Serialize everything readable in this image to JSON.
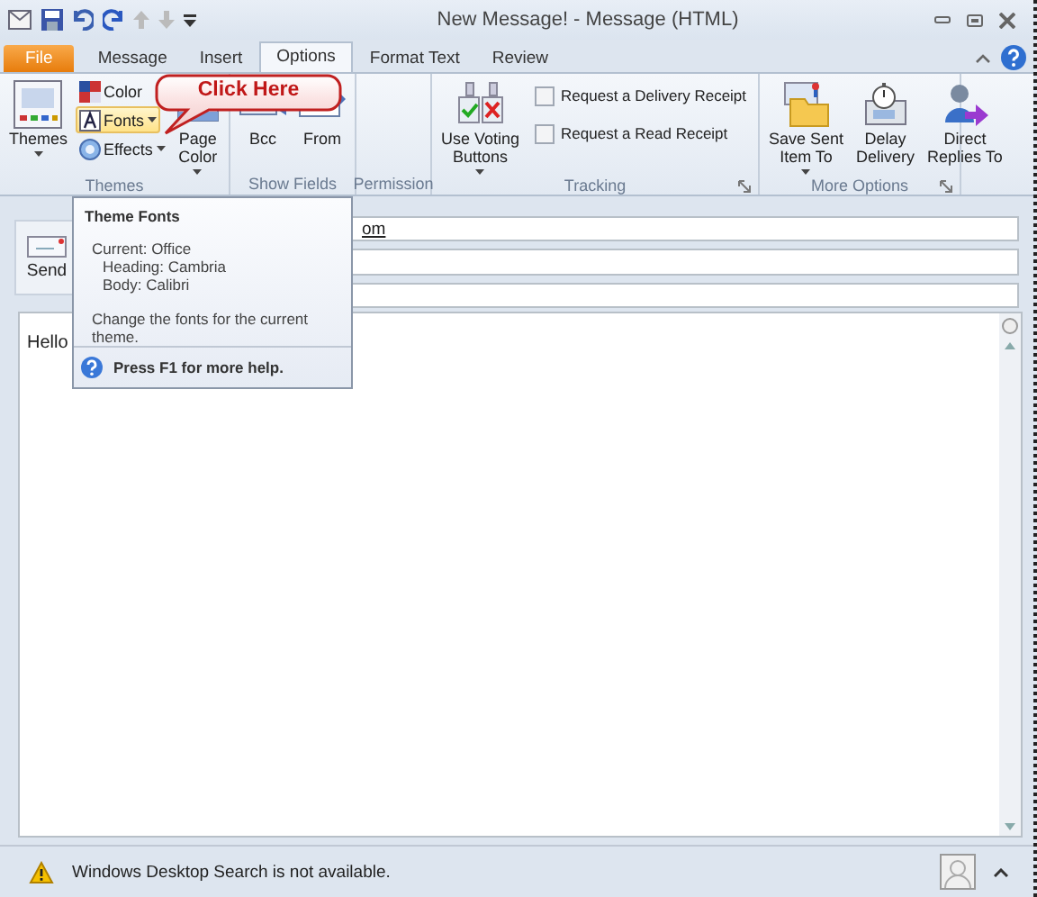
{
  "window": {
    "title": "New Message! - Message (HTML)"
  },
  "tabs": [
    {
      "label": "File",
      "kind": "file",
      "selected": false
    },
    {
      "label": "Message",
      "kind": "tab",
      "selected": false
    },
    {
      "label": "Insert",
      "kind": "tab",
      "selected": false
    },
    {
      "label": "Options",
      "kind": "tab",
      "selected": true
    },
    {
      "label": "Format Text",
      "kind": "tab",
      "selected": false
    },
    {
      "label": "Review",
      "kind": "tab",
      "selected": false
    }
  ],
  "ribbon": {
    "groups": [
      {
        "label": "Themes",
        "launcher": false,
        "columns": [
          [
            {
              "kind": "large",
              "label": "Themes",
              "dropdown": true,
              "highlighted": false
            }
          ],
          [
            {
              "kind": "small",
              "label": "Color",
              "dropdown": false,
              "highlighted": false
            },
            {
              "kind": "small",
              "label": "Fonts",
              "dropdown": true,
              "highlighted": true
            },
            {
              "kind": "small",
              "label": "Effects",
              "dropdown": true,
              "highlighted": false
            }
          ],
          [
            {
              "kind": "large",
              "label": "Page\nColor",
              "dropdown": true,
              "highlighted": false
            }
          ]
        ]
      },
      {
        "label": "Show Fields",
        "launcher": false,
        "columns": [
          [
            {
              "kind": "large",
              "label": "Bcc",
              "dropdown": false,
              "highlighted": false
            }
          ],
          [
            {
              "kind": "large",
              "label": "From",
              "dropdown": false,
              "highlighted": false
            }
          ]
        ]
      },
      {
        "label": "Permission",
        "launcher": false
      },
      {
        "label": "Tracking",
        "launcher": true,
        "columns": [
          [
            {
              "kind": "large",
              "label": "Use Voting\nButtons",
              "dropdown": true,
              "highlighted": false
            }
          ],
          [
            {
              "kind": "check",
              "label": "Request a Delivery Receipt",
              "checked": false
            },
            {
              "kind": "check",
              "label": "Request a Read Receipt",
              "checked": false
            }
          ]
        ]
      },
      {
        "label": "More Options",
        "launcher": true,
        "columns": [
          [
            {
              "kind": "large",
              "label": "Save Sent\nItem To",
              "dropdown": true,
              "highlighted": false
            }
          ],
          [
            {
              "kind": "large",
              "label": "Delay\nDelivery",
              "dropdown": false,
              "highlighted": false
            }
          ],
          [
            {
              "kind": "large",
              "label": "Direct\nReplies To",
              "dropdown": false,
              "highlighted": false
            }
          ]
        ]
      }
    ]
  },
  "callout": {
    "text": "Click Here"
  },
  "tooltip": {
    "title": "Theme Fonts",
    "lines": [
      {
        "text": "Current: Office",
        "children": [
          {
            "text": "Heading: Cambria"
          },
          {
            "text": "Body: Calibri"
          }
        ]
      }
    ],
    "description": "Change the fonts for the current theme.",
    "help": "Press F1 for more help."
  },
  "message": {
    "send": "Send",
    "to_value": "om",
    "body": "Hello"
  },
  "status_bar": {
    "text": "Windows Desktop Search is not available."
  }
}
